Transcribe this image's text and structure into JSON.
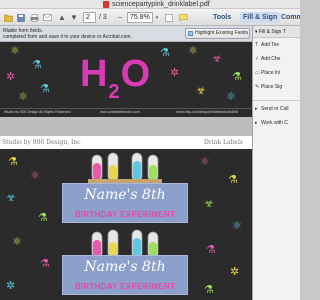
{
  "window": {
    "title": "sciencepartypink_drinklabel.pdf"
  },
  "toolbar": {
    "page_current": "2",
    "page_total": "/ 3",
    "zoom": "75.8%",
    "tabs": {
      "tools": "Tools",
      "fill_sign": "Fill & Sign",
      "comment": "Comm"
    }
  },
  "notice": {
    "line1": "fillable form fields.",
    "line2": "completed form and save it to your device or Acrobat.com.",
    "highlight_button": "Highlight Existing Fields"
  },
  "document": {
    "h2o": {
      "main": "H",
      "sub": "2",
      "tail": "O"
    },
    "footer_left": "Studio by 806 Design All Rights Reserved",
    "footer_mid": "www.printablestudio.com",
    "footer_right": "www.etsy.com/shop/printablestudio806",
    "page_header_left": "Studio by 806 Design, Inc",
    "page_header_right": "Drink Labels",
    "labels": [
      {
        "name": "Name's 8th",
        "event": "BIRTHDAY EXPERIMENT"
      },
      {
        "name": "Name's 8th",
        "event": "BIRTHDAY EXPERIMENT"
      }
    ]
  },
  "panel": {
    "header": "Fill & Sign T",
    "items": [
      "Add Tex",
      "Add Che",
      "Place Ini",
      "Place Sig"
    ],
    "sections": [
      "Send or Coll",
      "Work with C"
    ]
  },
  "colors": {
    "label_bg": "#2b2b2b",
    "accent_pink": "#d93ab6",
    "name_box": "#8da0cc"
  }
}
